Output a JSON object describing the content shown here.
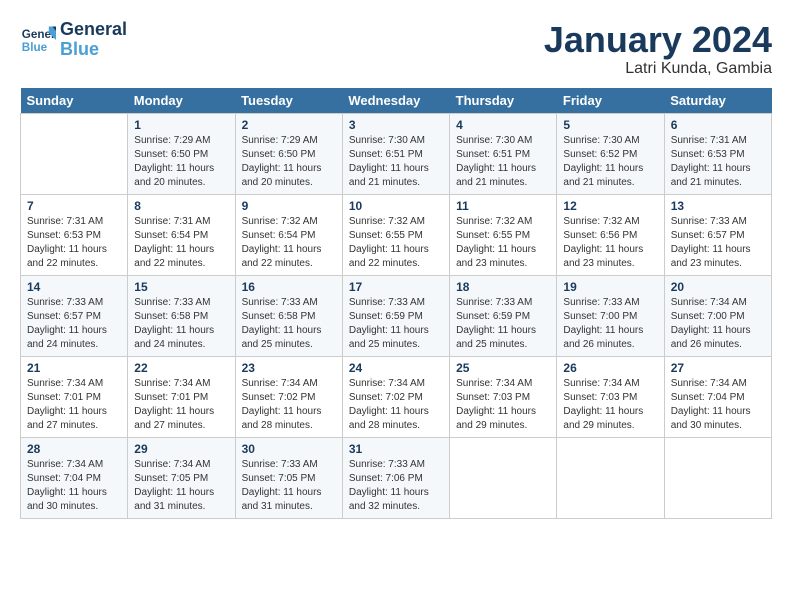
{
  "header": {
    "logo_line1": "General",
    "logo_line2": "Blue",
    "month": "January 2024",
    "location": "Latri Kunda, Gambia"
  },
  "weekdays": [
    "Sunday",
    "Monday",
    "Tuesday",
    "Wednesday",
    "Thursday",
    "Friday",
    "Saturday"
  ],
  "weeks": [
    [
      {
        "num": "",
        "info": ""
      },
      {
        "num": "1",
        "info": "Sunrise: 7:29 AM\nSunset: 6:50 PM\nDaylight: 11 hours\nand 20 minutes."
      },
      {
        "num": "2",
        "info": "Sunrise: 7:29 AM\nSunset: 6:50 PM\nDaylight: 11 hours\nand 20 minutes."
      },
      {
        "num": "3",
        "info": "Sunrise: 7:30 AM\nSunset: 6:51 PM\nDaylight: 11 hours\nand 21 minutes."
      },
      {
        "num": "4",
        "info": "Sunrise: 7:30 AM\nSunset: 6:51 PM\nDaylight: 11 hours\nand 21 minutes."
      },
      {
        "num": "5",
        "info": "Sunrise: 7:30 AM\nSunset: 6:52 PM\nDaylight: 11 hours\nand 21 minutes."
      },
      {
        "num": "6",
        "info": "Sunrise: 7:31 AM\nSunset: 6:53 PM\nDaylight: 11 hours\nand 21 minutes."
      }
    ],
    [
      {
        "num": "7",
        "info": "Sunrise: 7:31 AM\nSunset: 6:53 PM\nDaylight: 11 hours\nand 22 minutes."
      },
      {
        "num": "8",
        "info": "Sunrise: 7:31 AM\nSunset: 6:54 PM\nDaylight: 11 hours\nand 22 minutes."
      },
      {
        "num": "9",
        "info": "Sunrise: 7:32 AM\nSunset: 6:54 PM\nDaylight: 11 hours\nand 22 minutes."
      },
      {
        "num": "10",
        "info": "Sunrise: 7:32 AM\nSunset: 6:55 PM\nDaylight: 11 hours\nand 22 minutes."
      },
      {
        "num": "11",
        "info": "Sunrise: 7:32 AM\nSunset: 6:55 PM\nDaylight: 11 hours\nand 23 minutes."
      },
      {
        "num": "12",
        "info": "Sunrise: 7:32 AM\nSunset: 6:56 PM\nDaylight: 11 hours\nand 23 minutes."
      },
      {
        "num": "13",
        "info": "Sunrise: 7:33 AM\nSunset: 6:57 PM\nDaylight: 11 hours\nand 23 minutes."
      }
    ],
    [
      {
        "num": "14",
        "info": "Sunrise: 7:33 AM\nSunset: 6:57 PM\nDaylight: 11 hours\nand 24 minutes."
      },
      {
        "num": "15",
        "info": "Sunrise: 7:33 AM\nSunset: 6:58 PM\nDaylight: 11 hours\nand 24 minutes."
      },
      {
        "num": "16",
        "info": "Sunrise: 7:33 AM\nSunset: 6:58 PM\nDaylight: 11 hours\nand 25 minutes."
      },
      {
        "num": "17",
        "info": "Sunrise: 7:33 AM\nSunset: 6:59 PM\nDaylight: 11 hours\nand 25 minutes."
      },
      {
        "num": "18",
        "info": "Sunrise: 7:33 AM\nSunset: 6:59 PM\nDaylight: 11 hours\nand 25 minutes."
      },
      {
        "num": "19",
        "info": "Sunrise: 7:33 AM\nSunset: 7:00 PM\nDaylight: 11 hours\nand 26 minutes."
      },
      {
        "num": "20",
        "info": "Sunrise: 7:34 AM\nSunset: 7:00 PM\nDaylight: 11 hours\nand 26 minutes."
      }
    ],
    [
      {
        "num": "21",
        "info": "Sunrise: 7:34 AM\nSunset: 7:01 PM\nDaylight: 11 hours\nand 27 minutes."
      },
      {
        "num": "22",
        "info": "Sunrise: 7:34 AM\nSunset: 7:01 PM\nDaylight: 11 hours\nand 27 minutes."
      },
      {
        "num": "23",
        "info": "Sunrise: 7:34 AM\nSunset: 7:02 PM\nDaylight: 11 hours\nand 28 minutes."
      },
      {
        "num": "24",
        "info": "Sunrise: 7:34 AM\nSunset: 7:02 PM\nDaylight: 11 hours\nand 28 minutes."
      },
      {
        "num": "25",
        "info": "Sunrise: 7:34 AM\nSunset: 7:03 PM\nDaylight: 11 hours\nand 29 minutes."
      },
      {
        "num": "26",
        "info": "Sunrise: 7:34 AM\nSunset: 7:03 PM\nDaylight: 11 hours\nand 29 minutes."
      },
      {
        "num": "27",
        "info": "Sunrise: 7:34 AM\nSunset: 7:04 PM\nDaylight: 11 hours\nand 30 minutes."
      }
    ],
    [
      {
        "num": "28",
        "info": "Sunrise: 7:34 AM\nSunset: 7:04 PM\nDaylight: 11 hours\nand 30 minutes."
      },
      {
        "num": "29",
        "info": "Sunrise: 7:34 AM\nSunset: 7:05 PM\nDaylight: 11 hours\nand 31 minutes."
      },
      {
        "num": "30",
        "info": "Sunrise: 7:33 AM\nSunset: 7:05 PM\nDaylight: 11 hours\nand 31 minutes."
      },
      {
        "num": "31",
        "info": "Sunrise: 7:33 AM\nSunset: 7:06 PM\nDaylight: 11 hours\nand 32 minutes."
      },
      {
        "num": "",
        "info": ""
      },
      {
        "num": "",
        "info": ""
      },
      {
        "num": "",
        "info": ""
      }
    ]
  ]
}
